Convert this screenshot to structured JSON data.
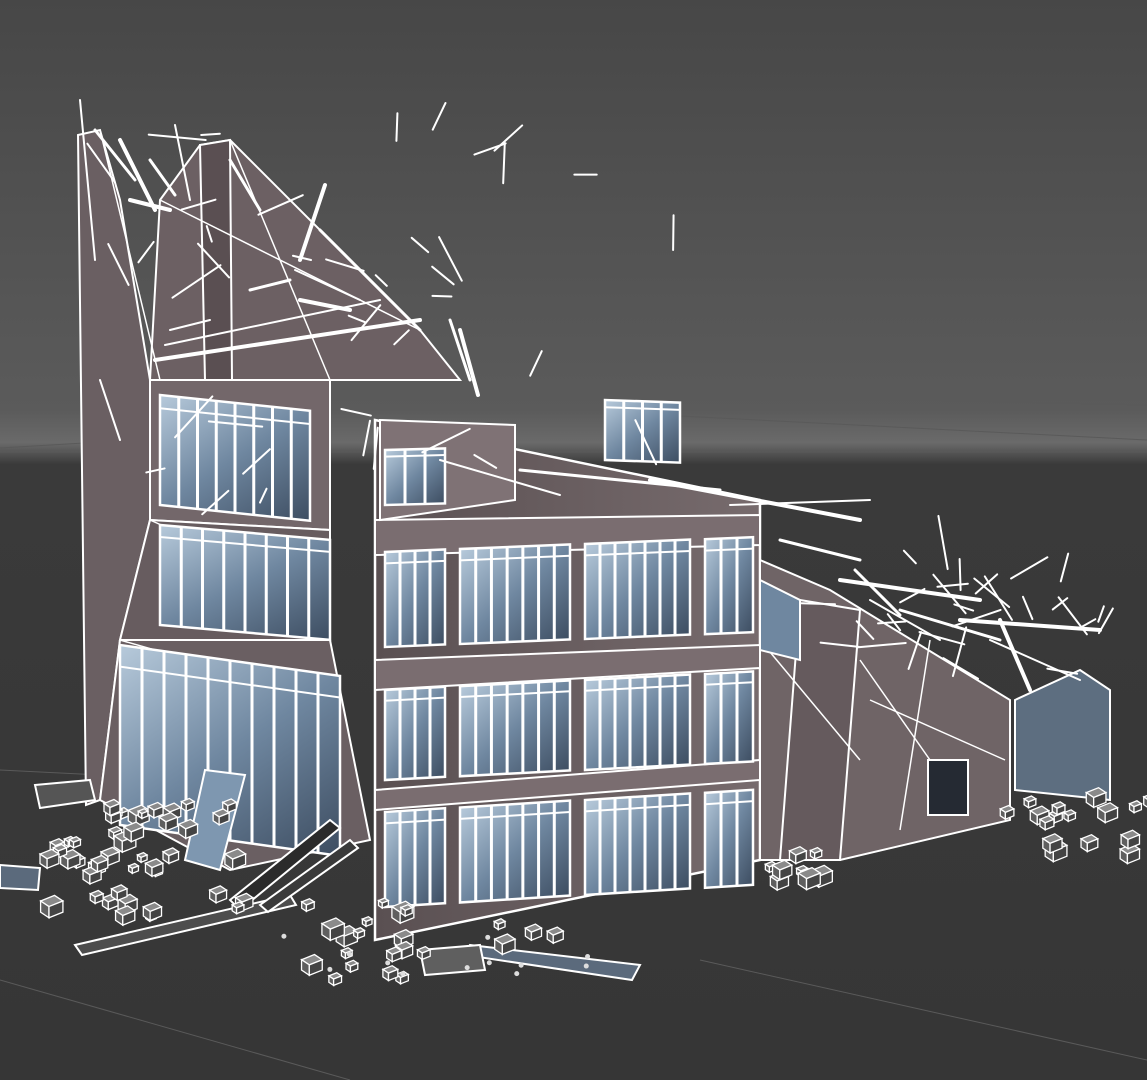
{
  "viewport": {
    "render_mode": "shaded-with-wireframe-overlay",
    "background_top": "#4a4a4a",
    "background_horizon": "#6a6a6a",
    "ground_color": "#333333",
    "wire_color": "#ffffff",
    "facade_color": "#6f6466",
    "facade_dark": "#574d50",
    "glass_color": "#6f87a0",
    "glass_light": "#a9c0d6"
  },
  "scene": {
    "object": "collapsed-building-mesh",
    "debris": "rubble-cubes",
    "floors_visible": 3
  }
}
